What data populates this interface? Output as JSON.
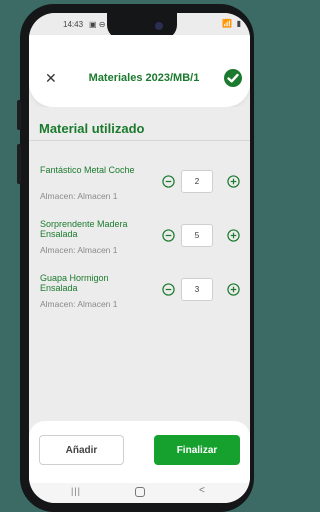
{
  "status_bar": {
    "time": "14:43",
    "left_icons": "▣ ⊖",
    "right_icons": "📶 ▮"
  },
  "header": {
    "title": "Materiales 2023/MB/1",
    "close_icon": "close-icon",
    "confirm_icon": "check-circle-icon",
    "accent_color": "#1c7a2e"
  },
  "section": {
    "title": "Material utilizado"
  },
  "materials": [
    {
      "name": "Fantástico Metal Coche",
      "store": "Almacen: Almacen 1",
      "quantity": "2"
    },
    {
      "name": "Sorprendente Madera Ensalada",
      "store": "Almacen: Almacen 1",
      "quantity": "5"
    },
    {
      "name": "Guapa Hormigon Ensalada",
      "store": "Almacen: Almacen 1",
      "quantity": "3"
    }
  ],
  "footer": {
    "add_label": "Añadir",
    "finish_label": "Finalizar",
    "finish_color": "#16a12e"
  },
  "nav_bar": {
    "recents": "|||",
    "back": "<"
  }
}
